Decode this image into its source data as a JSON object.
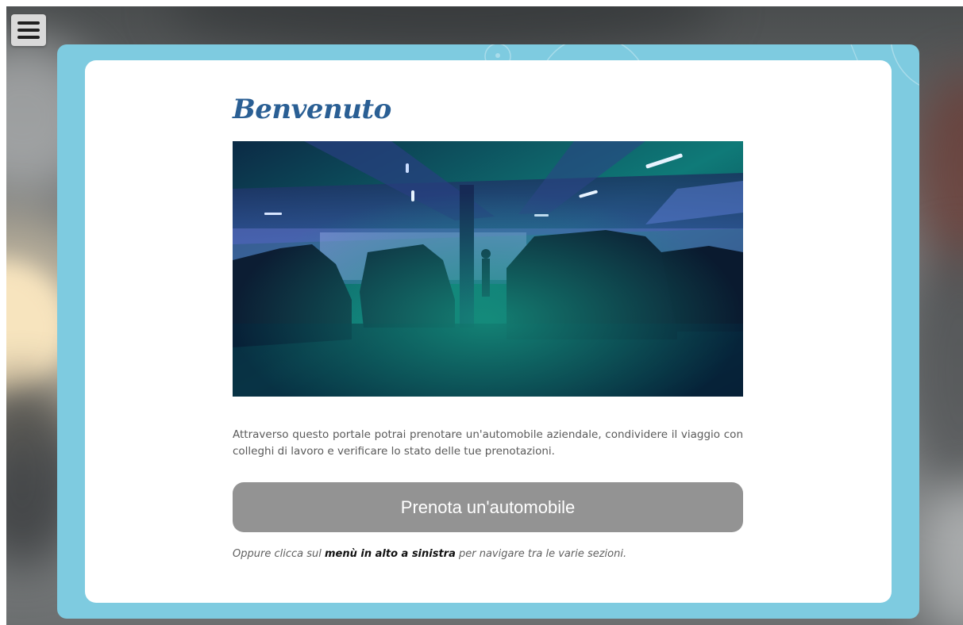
{
  "menu": {
    "toggle_icon": "hamburger-menu-icon"
  },
  "welcome": {
    "title": "Benvenuto",
    "hero_image_alt": "parking-garage-photo",
    "description": "Attraverso questo portale potrai prenotare un'automobile aziendale, condividere il viaggio con colleghi di lavoro e verificare lo stato delle tue prenotazioni.",
    "cta_label": "Prenota un'automobile",
    "footnote_before": "Oppure clicca sul ",
    "footnote_emphasis": "menù in alto a sinistra",
    "footnote_after": " per navigare tra le varie sezioni."
  },
  "colors": {
    "frame": "#7ecbe0",
    "title": "#2a5f94",
    "button": "#939393"
  }
}
